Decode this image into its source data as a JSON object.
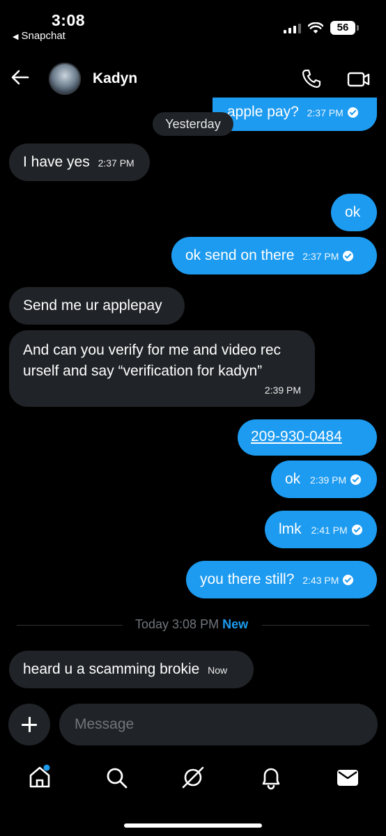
{
  "status_bar": {
    "time": "3:08",
    "back_app": "Snapchat",
    "battery": "56"
  },
  "header": {
    "contact_name": "Kadyn"
  },
  "messages": [
    {
      "side": "sent",
      "text": "apple pay?",
      "time": "2:37 PM",
      "read": true
    },
    {
      "side": "recv",
      "text": "I have yes",
      "time": "2:37 PM"
    },
    {
      "side": "sent",
      "text": "ok"
    },
    {
      "side": "sent",
      "text": "ok send on there",
      "time": "2:37 PM",
      "read": true
    },
    {
      "side": "recv",
      "text": "Send me ur applepay"
    },
    {
      "side": "recv",
      "text_line1": "And can you verify for me and video rec",
      "text_line2": "urself and say “verification for kadyn”",
      "time": "2:39 PM"
    },
    {
      "side": "sent",
      "text": "209-930-0484",
      "link": true
    },
    {
      "side": "sent",
      "text": "ok",
      "time": "2:39 PM",
      "read": true
    },
    {
      "side": "sent",
      "text": "lmk",
      "time": "2:41 PM",
      "read": true
    },
    {
      "side": "sent",
      "text": "you there still?",
      "time": "2:43 PM",
      "read": true
    },
    {
      "side": "recv",
      "text": "heard u a scamming brokie",
      "time": "Now"
    }
  ],
  "separators": {
    "yesterday": "Yesterday",
    "today": "Today 3:08 PM",
    "new": "New"
  },
  "composer": {
    "placeholder": "Message"
  },
  "tab_bar": {
    "items": [
      "home",
      "search",
      "grok",
      "notifications",
      "messages"
    ],
    "home_has_badge": true,
    "accent": "#1d9bf0"
  },
  "colors": {
    "sent_bubble": "#1d9bf0",
    "received_bubble": "#202327",
    "background": "#000000"
  }
}
